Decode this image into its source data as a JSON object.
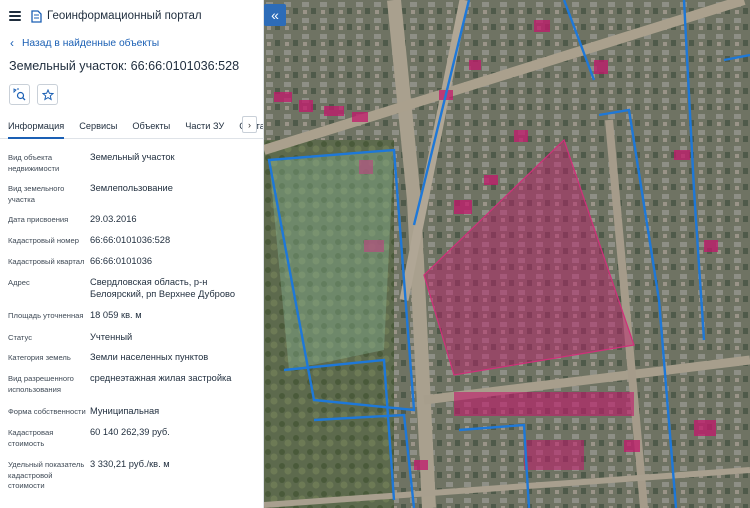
{
  "header": {
    "title": "Геоинформационный портал"
  },
  "back_link": {
    "label": "Назад в найденные объекты"
  },
  "object_title": "Земельный участок: 66:66:0101036:528",
  "tabs": [
    {
      "label": "Информация"
    },
    {
      "label": "Сервисы"
    },
    {
      "label": "Объекты"
    },
    {
      "label": "Части ЗУ"
    },
    {
      "label": "Состав"
    }
  ],
  "tab_next_icon": "chevron-right-icon",
  "properties": [
    {
      "label": "Вид объекта недвижимости",
      "value": "Земельный участок"
    },
    {
      "label": "Вид земельного участка",
      "value": "Землепользование"
    },
    {
      "label": "Дата присвоения",
      "value": "29.03.2016"
    },
    {
      "label": "Кадастровый номер",
      "value": "66:66:0101036:528"
    },
    {
      "label": "Кадастровый квартал",
      "value": "66:66:0101036"
    },
    {
      "label": "Адрес",
      "value": "Свердловская область, р-н Белоярский, рп Верхнее Дуброво"
    },
    {
      "label": "Площадь уточненная",
      "value": "18 059 кв. м"
    },
    {
      "label": "Статус",
      "value": "Учтенный"
    },
    {
      "label": "Категория земель",
      "value": "Земли населенных пунктов"
    },
    {
      "label": "Вид разрешенного использования",
      "value": "среднеэтажная жилая застройка"
    },
    {
      "label": "Форма собственности",
      "value": "Муниципальная"
    },
    {
      "label": "Кадастровая стоимость",
      "value": "60 140 262,39 руб."
    },
    {
      "label": "Удельный показатель кадастровой стоимости",
      "value": "3 330,21 руб./кв. м"
    }
  ],
  "colors": {
    "accent": "#1a5fb4",
    "parcel_fill": "#c2186b",
    "boundary": "#1e78d8"
  },
  "icons": [
    "menu-icon",
    "portal-logo-icon",
    "chevron-left-icon",
    "map-search-icon",
    "star-icon",
    "double-chevron-left-icon"
  ]
}
